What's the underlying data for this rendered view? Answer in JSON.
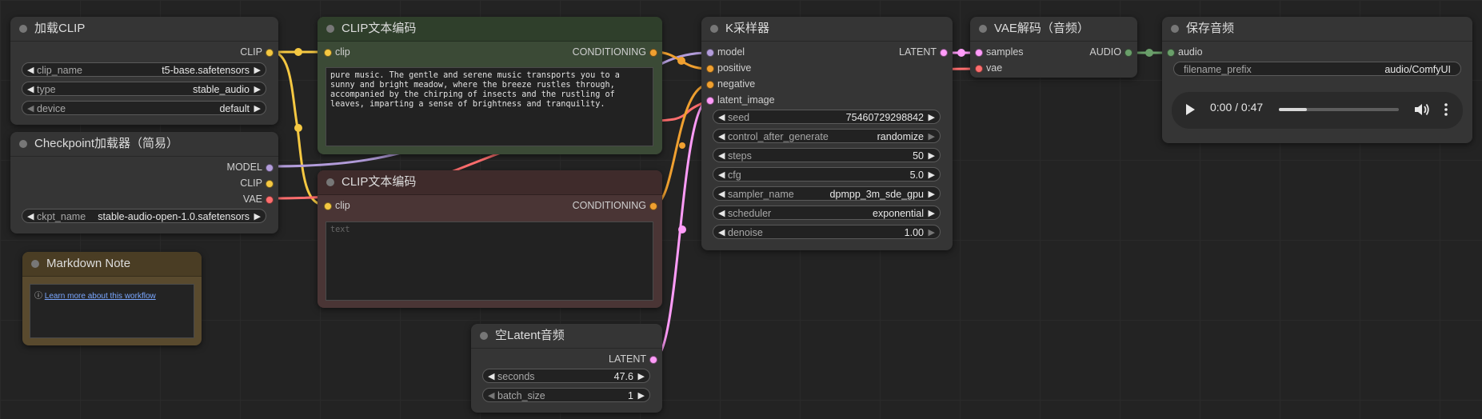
{
  "nodes": {
    "load_clip": {
      "title": "加载CLIP",
      "out_clip": "CLIP",
      "w_clip_name": {
        "name": "clip_name",
        "value": "t5-base.safetensors"
      },
      "w_type": {
        "name": "type",
        "value": "stable_audio"
      },
      "w_device": {
        "name": "device",
        "value": "default"
      }
    },
    "checkpoint": {
      "title": "Checkpoint加载器（简易）",
      "out_model": "MODEL",
      "out_clip": "CLIP",
      "out_vae": "VAE",
      "w_ckpt": {
        "name": "ckpt_name",
        "value": "stable-audio-open-1.0.safetensors"
      }
    },
    "markdown": {
      "title": "Markdown Note",
      "link": "Learn more about this workflow",
      "info_icon": "ⓘ"
    },
    "clip_pos": {
      "title": "CLIP文本编码",
      "in_clip": "clip",
      "out_cond": "CONDITIONING",
      "text": "pure music. The gentle and serene music transports you to a sunny and bright meadow, where the breeze rustles through, accompanied by the chirping of insects and the rustling of leaves, imparting a sense of brightness and tranquility."
    },
    "clip_neg": {
      "title": "CLIP文本编码",
      "in_clip": "clip",
      "out_cond": "CONDITIONING",
      "placeholder": "text"
    },
    "empty_latent": {
      "title": "空Latent音频",
      "out_latent": "LATENT",
      "w_seconds": {
        "name": "seconds",
        "value": "47.6"
      },
      "w_batch": {
        "name": "batch_size",
        "value": "1"
      }
    },
    "ksampler": {
      "title": "K采样器",
      "in_model": "model",
      "in_positive": "positive",
      "in_negative": "negative",
      "in_latent": "latent_image",
      "out_latent": "LATENT",
      "w_seed": {
        "name": "seed",
        "value": "75460729298842"
      },
      "w_control": {
        "name": "control_after_generate",
        "value": "randomize"
      },
      "w_steps": {
        "name": "steps",
        "value": "50"
      },
      "w_cfg": {
        "name": "cfg",
        "value": "5.0"
      },
      "w_sampler": {
        "name": "sampler_name",
        "value": "dpmpp_3m_sde_gpu"
      },
      "w_scheduler": {
        "name": "scheduler",
        "value": "exponential"
      },
      "w_denoise": {
        "name": "denoise",
        "value": "1.00"
      }
    },
    "vae_decode": {
      "title": "VAE解码（音频）",
      "in_samples": "samples",
      "in_vae": "vae",
      "out_audio": "AUDIO"
    },
    "save_audio": {
      "title": "保存音频",
      "in_audio": "audio",
      "w_prefix": {
        "name": "filename_prefix",
        "value": "audio/ComfyUI"
      },
      "player_time": "0:00 / 0:47",
      "player_progress": 0.23
    }
  },
  "colors": {
    "clip": "#f5c842",
    "model": "#b39ddb",
    "vae": "#ff6e6e",
    "conditioning": "#f0a030",
    "latent": "#ff9cf9",
    "audio": "#6a9f6a",
    "positive_node": "#3b4a36",
    "negative_node": "#4a3535",
    "markdown_node": "#594a2e"
  }
}
